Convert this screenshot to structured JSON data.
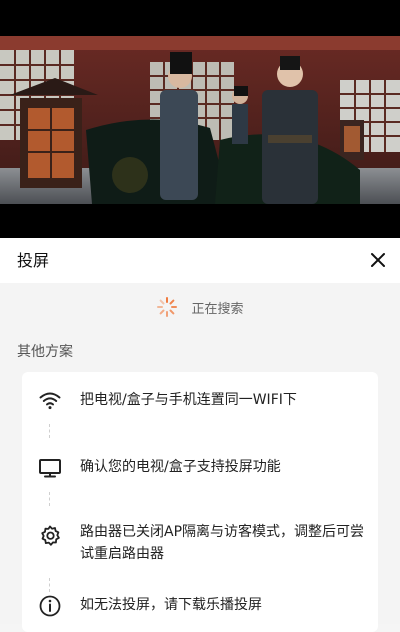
{
  "sheet": {
    "title": "投屏",
    "close_icon": "close-icon",
    "status_text": "正在搜索",
    "spinner_color": "#f07b3f",
    "section_label": "其他方案",
    "steps": [
      {
        "icon": "wifi-icon",
        "text": "把电视/盒子与手机连置同一WIFI下"
      },
      {
        "icon": "tv-icon",
        "text": "确认您的电视/盒子支持投屏功能"
      },
      {
        "icon": "gear-icon",
        "text": "路由器已关闭AP隔离与访客模式，调整后可尝试重启路由器"
      },
      {
        "icon": "info-icon",
        "text": "如无法投屏，请下载乐播投屏"
      }
    ]
  }
}
